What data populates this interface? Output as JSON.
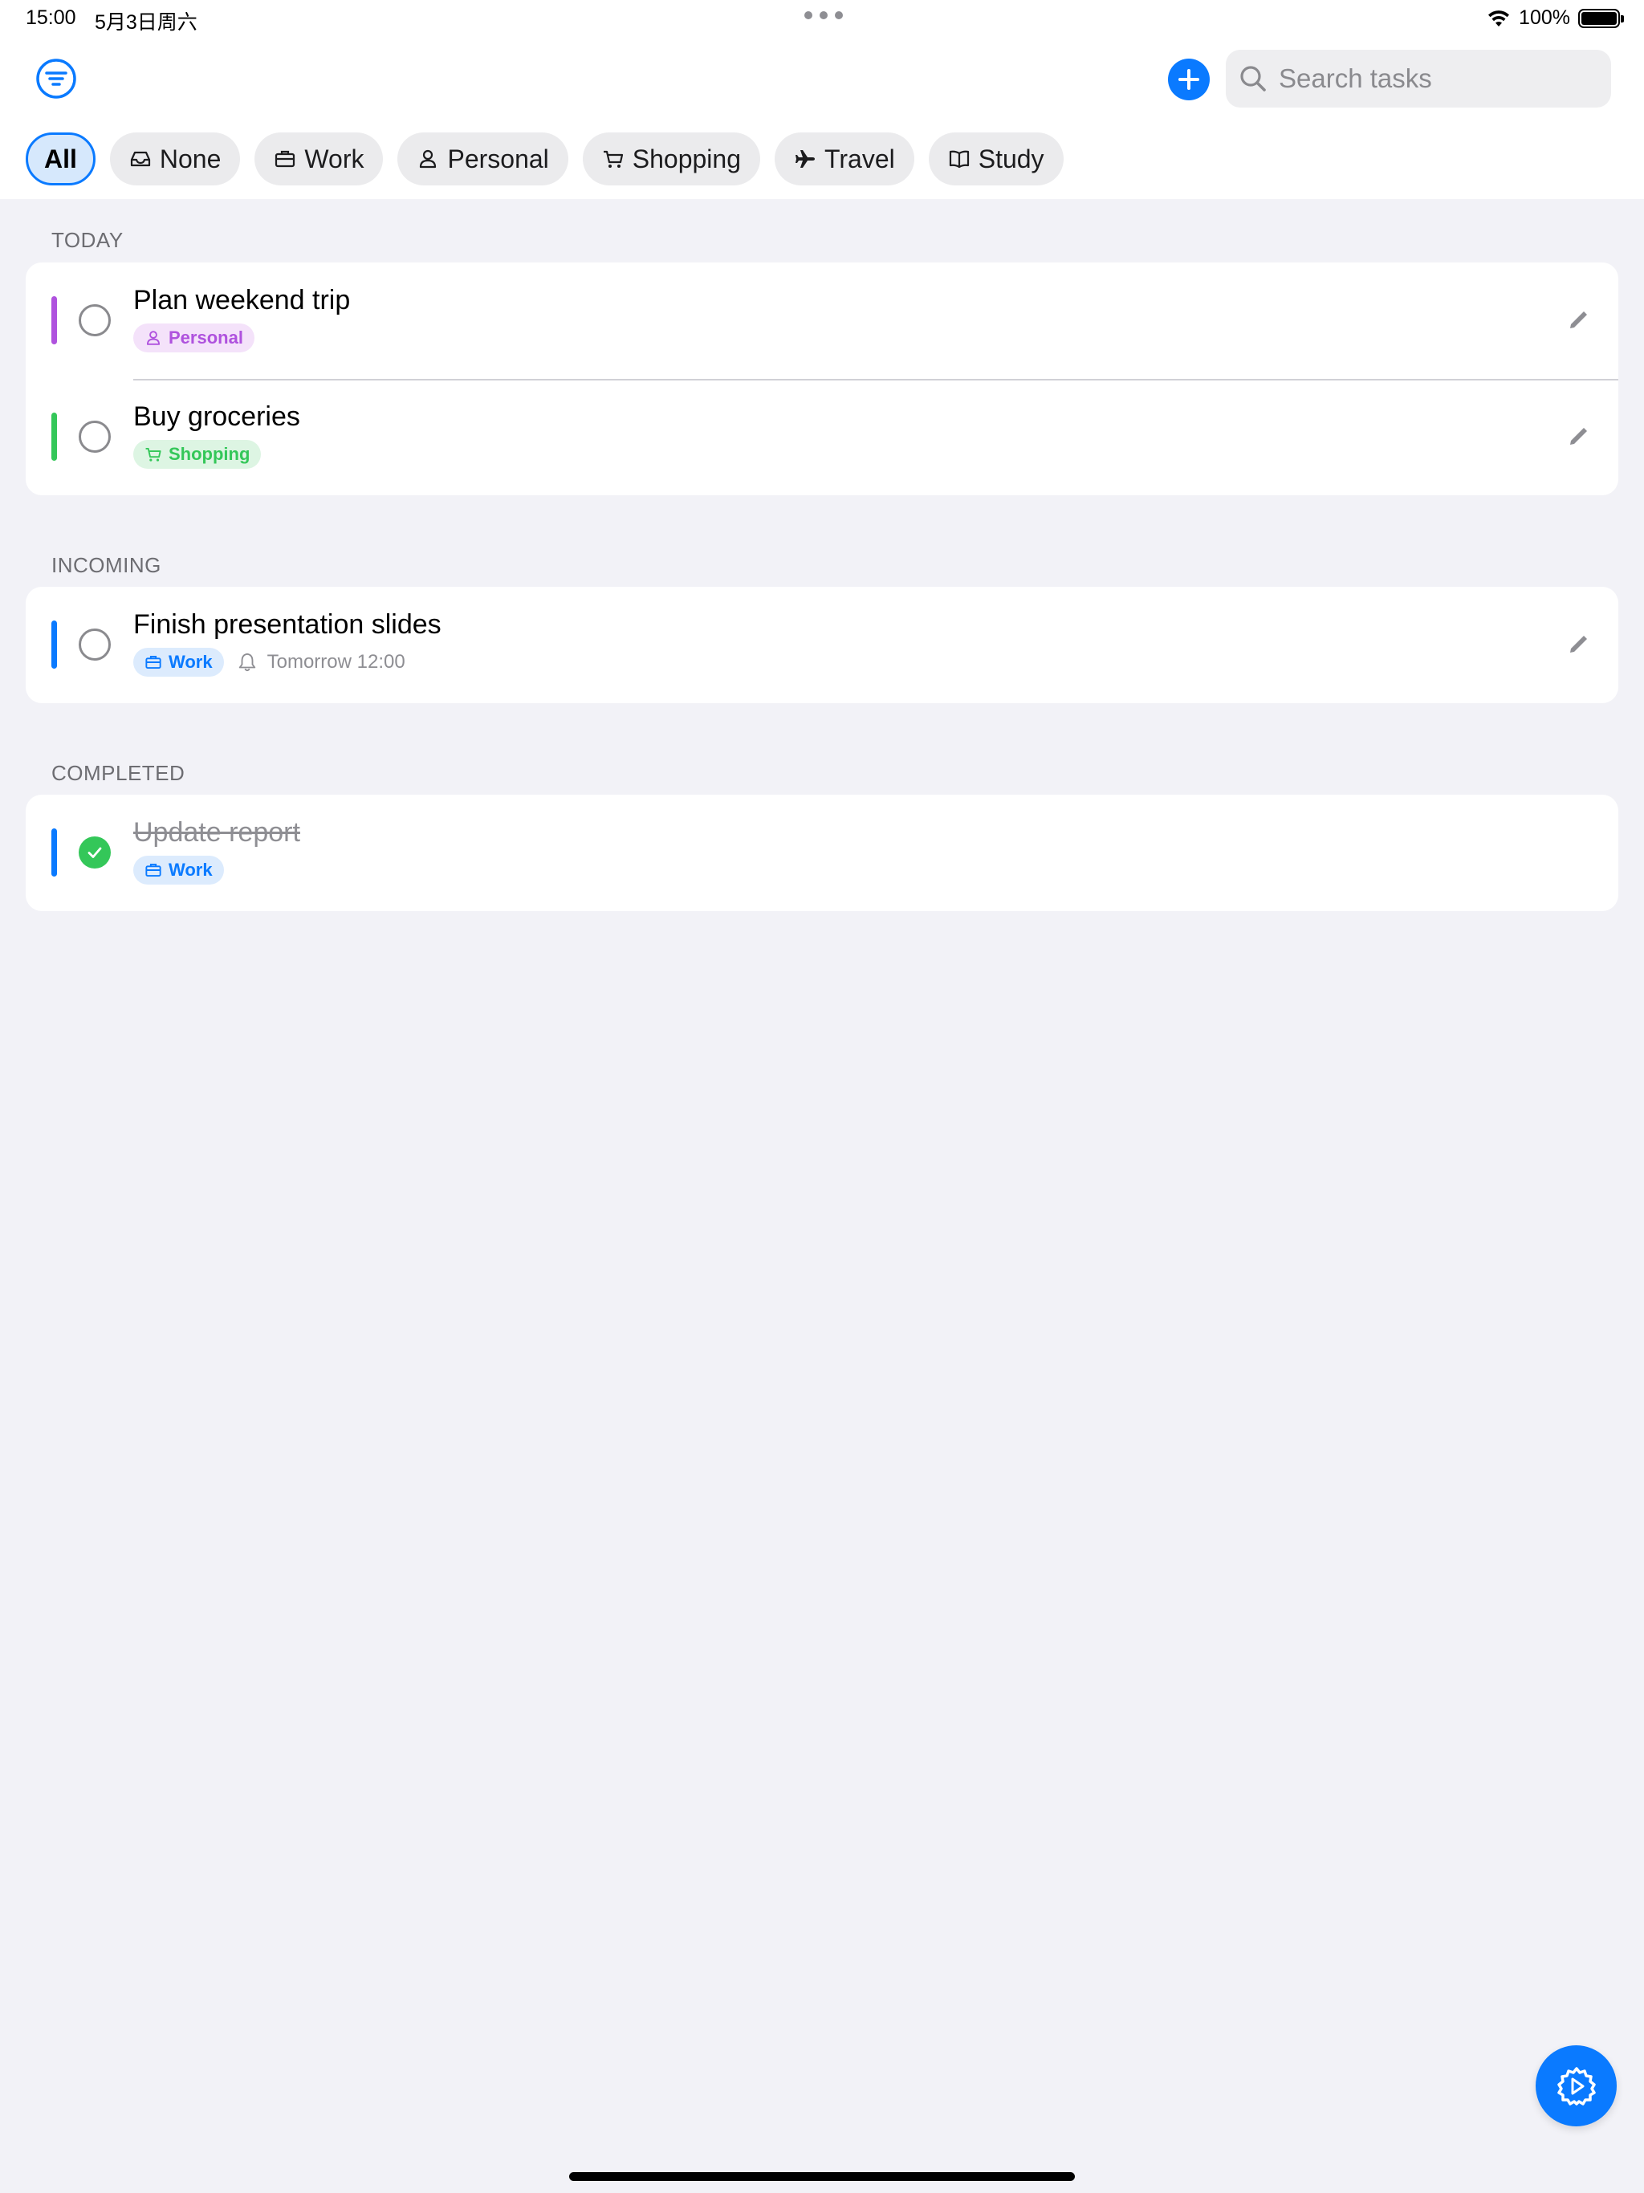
{
  "status_bar": {
    "time": "15:00",
    "date": "5月3日周六",
    "battery": "100%"
  },
  "toolbar": {
    "search_placeholder": "Search tasks"
  },
  "categories": [
    {
      "label": "All",
      "icon": "none",
      "active": true
    },
    {
      "label": "None",
      "icon": "tray-icon"
    },
    {
      "label": "Work",
      "icon": "briefcase-icon"
    },
    {
      "label": "Personal",
      "icon": "person-icon"
    },
    {
      "label": "Shopping",
      "icon": "cart-icon"
    },
    {
      "label": "Travel",
      "icon": "airplane-icon"
    },
    {
      "label": "Study",
      "icon": "book-icon"
    }
  ],
  "sections": {
    "today": {
      "label": "TODAY",
      "tasks": [
        {
          "title": "Plan weekend trip",
          "tag": "Personal",
          "color": "#AF52DE",
          "completed": false
        },
        {
          "title": "Buy groceries",
          "tag": "Shopping",
          "color": "#34C759",
          "completed": false
        }
      ]
    },
    "incoming": {
      "label": "INCOMING",
      "tasks": [
        {
          "title": "Finish presentation slides",
          "tag": "Work",
          "color": "#0A7AFF",
          "reminder": "Tomorrow 12:00",
          "completed": false
        }
      ]
    },
    "completed": {
      "label": "COMPLETED",
      "tasks": [
        {
          "title": "Update report",
          "tag": "Work",
          "color": "#0A7AFF",
          "completed": true
        }
      ]
    }
  },
  "colors": {
    "accent": "#0A7AFF",
    "personal": "#AF52DE",
    "shopping": "#34C759",
    "work": "#0A7AFF",
    "background": "#F2F2F7"
  }
}
